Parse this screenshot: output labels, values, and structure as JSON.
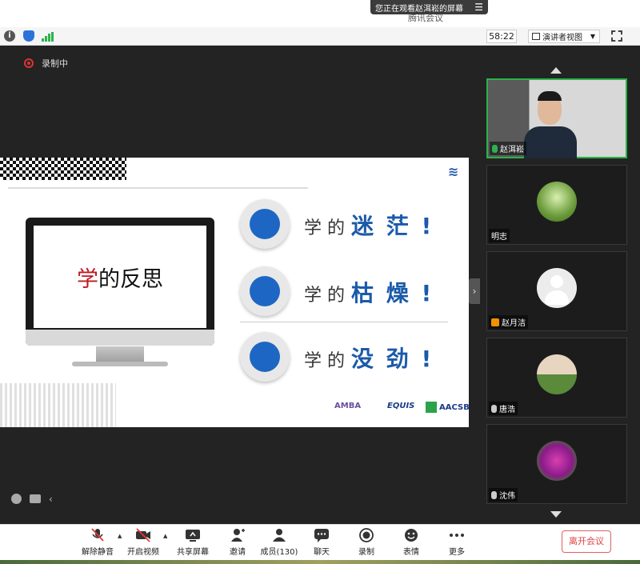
{
  "window": {
    "share_banner": "您正在观看赵洱崧的屏幕",
    "meeting_title": "腾讯会议",
    "timer": "58:22",
    "view_mode": "演讲者视图"
  },
  "recording_label": "录制中",
  "slide": {
    "title_red": "学",
    "title_rest": "的反思",
    "items": [
      {
        "prefix": "学 的",
        "highlight": "迷 茫 !"
      },
      {
        "prefix": "学 的",
        "highlight": "枯 燥 !"
      },
      {
        "prefix": "学 的",
        "highlight": "没 劲 !"
      }
    ],
    "accreditations": [
      "AMBA",
      "EQUIS",
      "AACSB"
    ]
  },
  "participants": [
    {
      "name": "赵洱崧",
      "mic": "on",
      "type": "video"
    },
    {
      "name": "明志",
      "mic": "off",
      "type": "forest"
    },
    {
      "name": "赵月洁",
      "mic": "off",
      "type": "default"
    },
    {
      "name": "唐浩",
      "mic": "off",
      "type": "sky"
    },
    {
      "name": "沈伟",
      "mic": "off",
      "type": "flower"
    }
  ],
  "toolbar": {
    "unmute": "解除静音",
    "start_video": "开启视频",
    "share_screen": "共享屏幕",
    "invite": "邀请",
    "members": "成员(130)",
    "chat": "聊天",
    "record": "录制",
    "reactions": "表情",
    "more": "更多",
    "leave": "离开会议"
  },
  "colors": {
    "accent_green": "#2bb24c",
    "slide_blue": "#1a5aaa",
    "slide_red": "#c0181e",
    "leave_red": "#e04040"
  }
}
